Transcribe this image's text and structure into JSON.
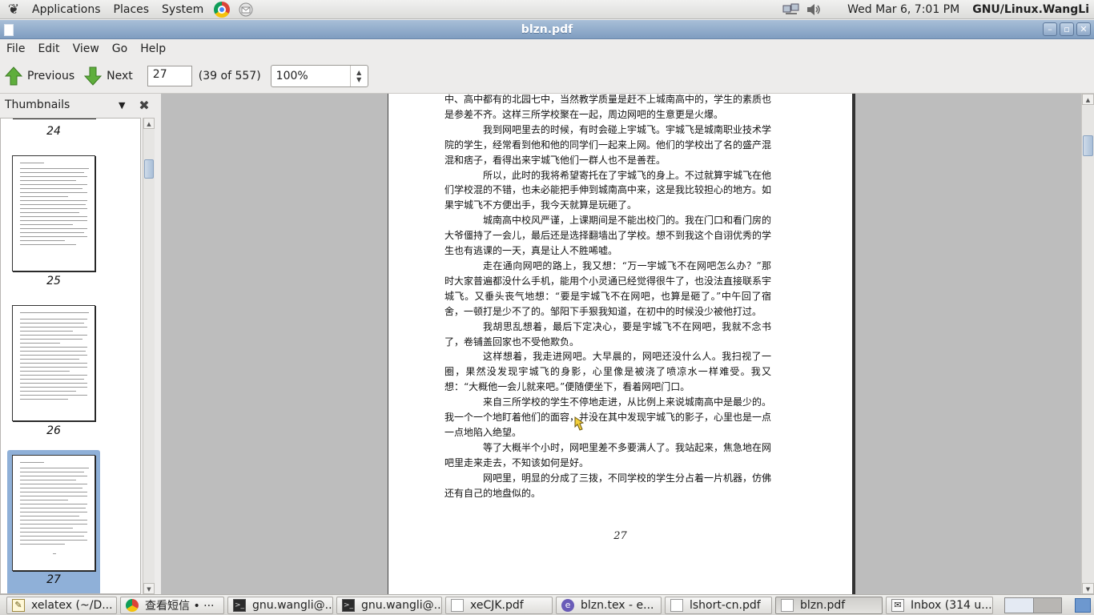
{
  "top_panel": {
    "menus": [
      "Applications",
      "Places",
      "System"
    ],
    "clock": "Wed Mar  6,  7:01 PM",
    "username": "GNU/Linux.WangLi",
    "icons": [
      "gnome-foot-icon",
      "chrome-icon",
      "mail-notifier-icon",
      "network-icon",
      "volume-icon"
    ]
  },
  "window": {
    "title": "blzn.pdf",
    "buttons": [
      "minimize",
      "maximize",
      "close"
    ]
  },
  "menubar": {
    "items": [
      "File",
      "Edit",
      "View",
      "Go",
      "Help"
    ]
  },
  "toolbar": {
    "previous_label": "Previous",
    "next_label": "Next",
    "page_input": "27",
    "page_count": "(39 of 557)",
    "zoom": "100%"
  },
  "sidebar": {
    "header": "Thumbnails",
    "thumbnails": [
      {
        "label": "24",
        "selected": false
      },
      {
        "label": "25",
        "selected": false
      },
      {
        "label": "26",
        "selected": false
      },
      {
        "label": "27",
        "selected": true
      }
    ]
  },
  "document": {
    "paragraphs": [
      {
        "indent": false,
        "text": "中、高中都有的北园七中，当然教学质量是赶不上城南高中的，学生的素质也是参差不齐。这样三所学校聚在一起，周边网吧的生意更是火爆。"
      },
      {
        "indent": true,
        "text": "我到网吧里去的时候，有时会碰上宇城飞。宇城飞是城南职业技术学院的学生，经常看到他和他的同学们一起来上网。他们的学校出了名的盛产混混和痞子，看得出来宇城飞他们一群人也不是善茬。"
      },
      {
        "indent": true,
        "text": "所以，此时的我将希望寄托在了宇城飞的身上。不过就算宇城飞在他们学校混的不错，也未必能把手伸到城南高中来，这是我比较担心的地方。如果宇城飞不方便出手，我今天就算是玩砸了。"
      },
      {
        "indent": true,
        "text": "城南高中校风严谨，上课期间是不能出校门的。我在门口和看门房的大爷僵持了一会儿，最后还是选择翻墙出了学校。想不到我这个自诩优秀的学生也有逃课的一天，真是让人不胜唏嘘。"
      },
      {
        "indent": true,
        "text": "走在通向网吧的路上，我又想：“万一宇城飞不在网吧怎么办？”那时大家普遍都没什么手机，能用个小灵通已经觉得很牛了，也没法直接联系宇城飞。又垂头丧气地想：“要是宇城飞不在网吧，也算是砸了。”中午回了宿舍，一顿打是少不了的。邹阳下手狠我知道，在初中的时候没少被他打过。"
      },
      {
        "indent": true,
        "text": "我胡思乱想着，最后下定决心，要是宇城飞不在网吧，我就不念书了，卷铺盖回家也不受他欺负。"
      },
      {
        "indent": true,
        "text": "这样想着，我走进网吧。大早晨的，网吧还没什么人。我扫视了一圈，果然没发现宇城飞的身影，心里像是被浇了喷凉水一样难受。我又想：“大概他一会儿就来吧。”便随便坐下，看着网吧门口。"
      },
      {
        "indent": true,
        "text": "来自三所学校的学生不停地走进，从比例上来说城南高中是最少的。我一个一个地盯着他们的面容，并没在其中发现宇城飞的影子，心里也是一点一点地陷入绝望。"
      },
      {
        "indent": true,
        "text": "等了大概半个小时，网吧里差不多要满人了。我站起来，焦急地在网吧里走来走去，不知该如何是好。"
      },
      {
        "indent": true,
        "text": "网吧里，明显的分成了三拨，不同学校的学生分占着一片机器，仿佛还有自己的地盘似的。"
      }
    ],
    "page_number": "27"
  },
  "taskbar": {
    "tasks": [
      {
        "label": "xelatex (~/D...",
        "icon": "edit",
        "active": false
      },
      {
        "label": "查看短信 • ···",
        "icon": "chrome",
        "active": false
      },
      {
        "label": "gnu.wangli@...",
        "icon": "term",
        "active": false
      },
      {
        "label": "gnu.wangli@...",
        "icon": "term",
        "active": false
      },
      {
        "label": "xeCJK.pdf",
        "icon": "doc",
        "active": false
      },
      {
        "label": "blzn.tex - e...",
        "icon": "emacs",
        "active": false
      },
      {
        "label": "lshort-cn.pdf",
        "icon": "doc",
        "active": false
      },
      {
        "label": "blzn.pdf",
        "icon": "doc",
        "active": true
      },
      {
        "label": "Inbox (314 u...",
        "icon": "mail",
        "active": false
      }
    ]
  }
}
